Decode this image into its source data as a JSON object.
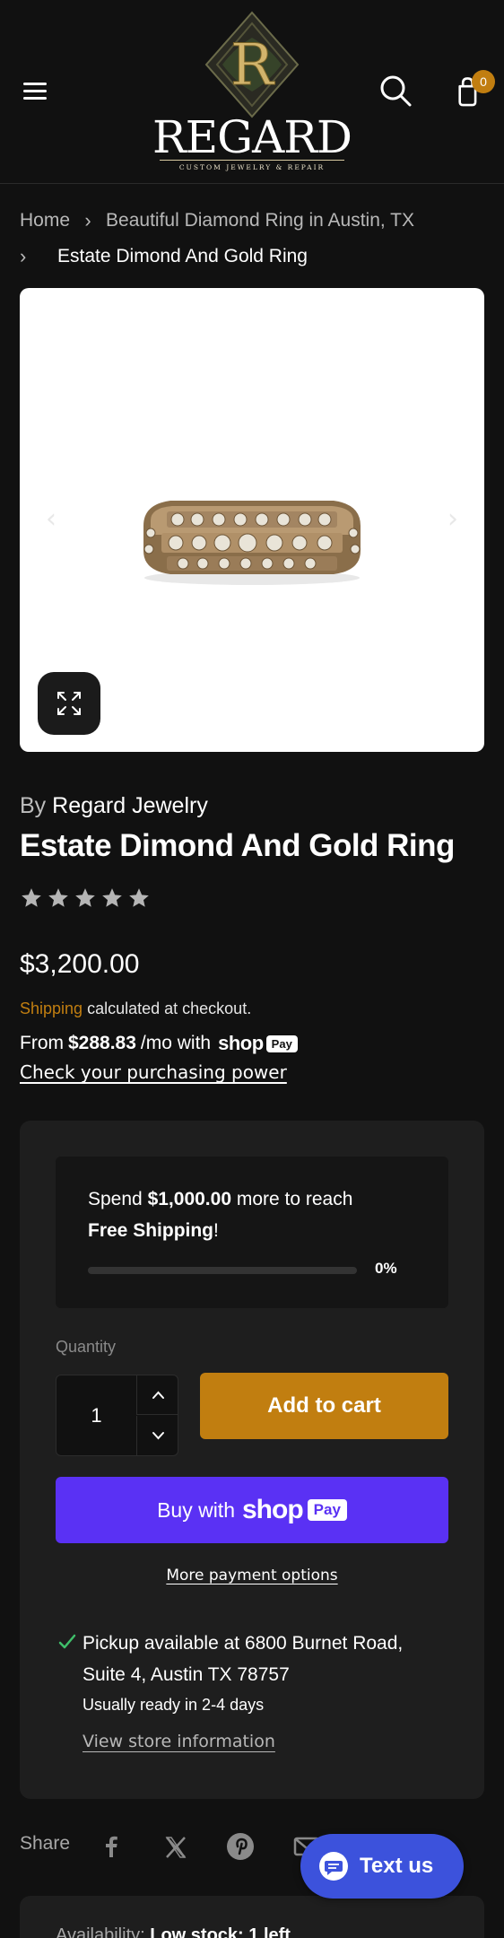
{
  "header": {
    "logo_text": "REGARD",
    "logo_subtitle": "CUSTOM JEWELRY & REPAIR",
    "logo_monogram": "R",
    "cart_count": "0"
  },
  "breadcrumb": {
    "home": "Home",
    "collection": "Beautiful Diamond Ring in Austin, TX",
    "current": "Estate Dimond And Gold Ring",
    "separator": "›"
  },
  "gallery": {
    "prev_arrow": "‹",
    "next_arrow": "›"
  },
  "product": {
    "vendor_prefix": "By",
    "vendor": "Regard Jewelry",
    "title": "Estate Dimond And Gold Ring",
    "rating_stars": 5,
    "price": "$3,200.00",
    "shipping_link": "Shipping",
    "shipping_rest": "calculated at checkout.",
    "installment_prefix": "From",
    "installment_amount": "$288.83",
    "installment_suffix": "/mo with",
    "shop_word": "shop",
    "pay_word": "Pay",
    "purchasing_power": "Check your purchasing power"
  },
  "buybox": {
    "spend_prefix": "Spend",
    "spend_amount": "$1,000.00",
    "spend_suffix": "more to reach",
    "free_shipping": "Free Shipping",
    "free_shipping_end": "!",
    "progress_percent": 0,
    "progress_label": "0%",
    "quantity_label": "Quantity",
    "quantity_value": "1",
    "add_to_cart": "Add to cart",
    "buy_with": "Buy with",
    "shop_word": "shop",
    "pay_word": "Pay",
    "more_payment": "More payment options",
    "pickup_text": "Pickup available at 6800 Burnet Road, Suite 4, Austin TX 78757",
    "pickup_ready": "Usually ready in 2-4 days",
    "store_info": "View store information"
  },
  "share": {
    "label": "Share",
    "icons": [
      "facebook-icon",
      "x-icon",
      "pinterest-icon",
      "email-icon"
    ]
  },
  "availability": {
    "label": "Availability:",
    "value": "Low stock: 1 left"
  },
  "chat": {
    "label": "Text us"
  },
  "colors": {
    "background": "#111111",
    "accent": "#c17e10",
    "shop_pay": "#5a31f4",
    "chat": "#3c52dc",
    "check": "#3fbf6a"
  }
}
